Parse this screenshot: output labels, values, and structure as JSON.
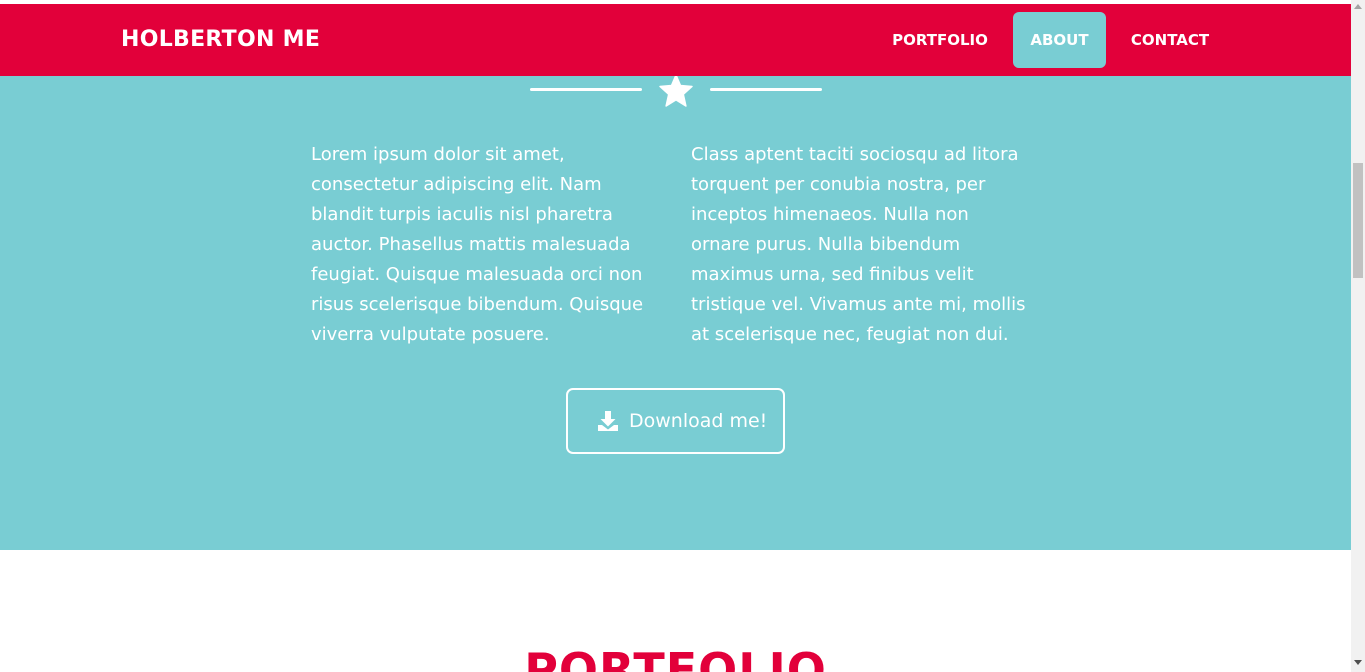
{
  "navbar": {
    "brand": "HOLBERTON ME",
    "items": [
      {
        "label": "PORTFOLIO",
        "active": false
      },
      {
        "label": "ABOUT",
        "active": true
      },
      {
        "label": "CONTACT",
        "active": false
      }
    ]
  },
  "about": {
    "divider_icon": "star-icon",
    "paragraph_left": "Lorem ipsum dolor sit amet, consectetur adipiscing elit. Nam blandit turpis iaculis nisl pharetra auctor. Phasellus mattis malesuada feugiat. Quisque malesuada orci non risus scelerisque bibendum. Quisque viverra vulputate posuere.",
    "paragraph_right": "Class aptent taciti sociosqu ad litora torquent per conubia nostra, per inceptos himenaeos. Nulla non ornare purus. Nulla bibendum maximus urna, sed finibus velit tristique vel. Vivamus ante mi, mollis at scelerisque nec, feugiat non dui.",
    "download_button": {
      "label": "Download me!",
      "icon": "download-icon"
    }
  },
  "portfolio": {
    "heading": "PORTFOLIO"
  },
  "colors": {
    "primary": "#e2003a",
    "secondary": "#79cdd3",
    "text_light": "#ffffff",
    "background": "#ffffff"
  }
}
